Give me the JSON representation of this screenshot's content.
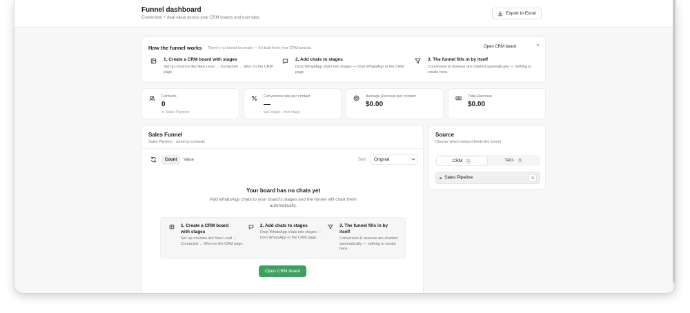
{
  "header": {
    "title": "Funnel dashboard",
    "subtitle": "Conversion + deal value across your CRM boards and user tabs.",
    "export_label": "Export to Excel"
  },
  "how": {
    "title": "How the funnel works",
    "subtitle": "There's no funnel to create — it's built from your CRM boards.",
    "open_label": "Open CRM board",
    "close_label": "×",
    "steps": [
      {
        "title": "1. Create a CRM board with stages",
        "desc": "Set up columns like New Lead → Contacted → Won on the CRM page.",
        "icon": "board-icon"
      },
      {
        "title": "2. Add chats to stages",
        "desc": "Drop WhatsApp chats into stages — from WhatsApp or the CRM page.",
        "icon": "chat-icon"
      },
      {
        "title": "3. The funnel fills in by itself",
        "desc": "Conversion & revenue are charted automatically — nothing to create here.",
        "icon": "filter-icon"
      }
    ]
  },
  "stats": [
    {
      "label": "Contacts",
      "value": "0",
      "note": "in Sales Pipeline",
      "icon": "users-icon"
    },
    {
      "label": "Conversion rate per contact",
      "value": "—",
      "note": "last stage ÷ first stage",
      "icon": "percent-icon"
    },
    {
      "label": "Average Revenue per contact",
      "value": "$0.00",
      "note": "",
      "icon": "coin-icon"
    },
    {
      "label": "Total Revenue",
      "value": "$0.00",
      "note": "",
      "icon": "cash-icon"
    }
  ],
  "funnel": {
    "title": "Sales Funnel",
    "subtitle": "Sales Pipeline · sized by contacts",
    "seg_count": "Count",
    "seg_value": "Value",
    "sort_label": "Sort",
    "sort_value": "Original",
    "empty_title": "Your board has no chats yet",
    "empty_desc": "Add WhatsApp chats to your board's stages and the funnel will chart them automatically.",
    "steps": [
      {
        "title": "1. Create a CRM board with stages",
        "desc": "Set up columns like New Lead → Contacted → Won on the CRM page."
      },
      {
        "title": "2. Add chats to stages",
        "desc": "Drop WhatsApp chats into stages — from WhatsApp or the CRM page."
      },
      {
        "title": "3. The funnel fills in by itself",
        "desc": "Conversion & revenue are charted automatically — nothing to create here."
      }
    ],
    "open_label": "Open CRM board"
  },
  "source": {
    "title": "Source",
    "subtitle": "Choose which dataset feeds the funnel",
    "tab_crm": "CRM",
    "tab_crm_count": "1",
    "tab_tabs": "Tabs",
    "tab_tabs_count": "0",
    "item_name": "Sales Pipeline",
    "item_count": "0"
  },
  "colors": {
    "accent_green": "#3fa061"
  }
}
